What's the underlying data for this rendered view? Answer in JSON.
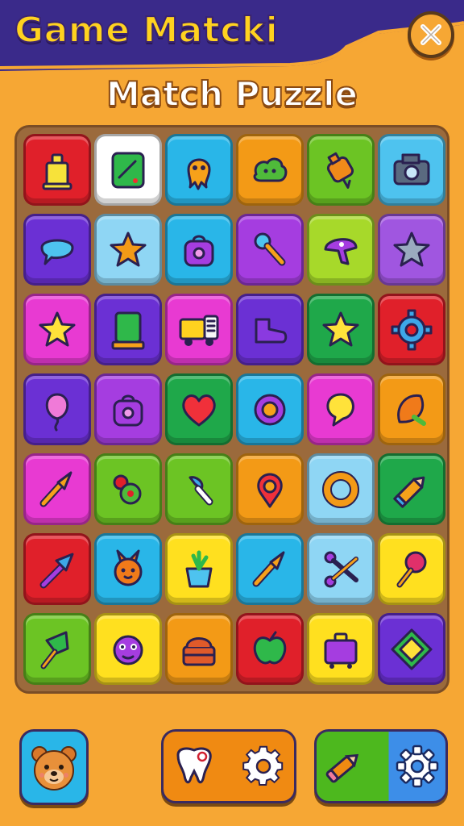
{
  "header": {
    "title": "Game Matcki",
    "subtitle": "Match Puzzle"
  },
  "colors": {
    "background": "#f6a734",
    "header": "#3a2a8a",
    "title": "#ffd21f",
    "board": "#9b6a3c"
  },
  "board": {
    "columns": 6,
    "rows": 7,
    "tiles": [
      [
        {
          "color": "#e0202a",
          "icon": "yellow-bottle-icon"
        },
        {
          "color": "#ffffff",
          "icon": "green-device-icon"
        },
        {
          "color": "#29b6e8",
          "icon": "orange-creature-icon"
        },
        {
          "color": "#f39a16",
          "icon": "green-bush-icon"
        },
        {
          "color": "#6cc424",
          "icon": "orange-flask-icon"
        },
        {
          "color": "#4ec3ef",
          "icon": "camera-icon"
        }
      ],
      [
        {
          "color": "#6b30d4",
          "icon": "speech-bubble-icon"
        },
        {
          "color": "#8fd6f4",
          "icon": "orange-star-icon"
        },
        {
          "color": "#29b6e8",
          "icon": "purple-bag-icon"
        },
        {
          "color": "#a53de0",
          "icon": "wrench-icon"
        },
        {
          "color": "#a7d92a",
          "icon": "purple-mushroom-icon"
        },
        {
          "color": "#a056e0",
          "icon": "gray-star-icon"
        }
      ],
      [
        {
          "color": "#e83ad2",
          "icon": "yellow-star-icon"
        },
        {
          "color": "#6b30d4",
          "icon": "green-card-icon"
        },
        {
          "color": "#e83ad2",
          "icon": "truck-icon"
        },
        {
          "color": "#6b30d4",
          "icon": "purple-boot-icon"
        },
        {
          "color": "#1fa84a",
          "icon": "yellow-star-icon"
        },
        {
          "color": "#e0202a",
          "icon": "blue-gear-icon"
        }
      ],
      [
        {
          "color": "#6b30d4",
          "icon": "pink-balloon-icon"
        },
        {
          "color": "#a53de0",
          "icon": "purple-bag-icon"
        },
        {
          "color": "#1fa84a",
          "icon": "heart-icon"
        },
        {
          "color": "#29b6e8",
          "icon": "purple-flower-icon"
        },
        {
          "color": "#e83ad2",
          "icon": "yellow-bubble-icon"
        },
        {
          "color": "#f39a16",
          "icon": "orange-leaf-icon"
        }
      ],
      [
        {
          "color": "#e83ad2",
          "icon": "brush-icon"
        },
        {
          "color": "#6cc424",
          "icon": "berry-icon"
        },
        {
          "color": "#6cc424",
          "icon": "blue-brush-icon"
        },
        {
          "color": "#f39a16",
          "icon": "location-pin-icon"
        },
        {
          "color": "#8fd6f4",
          "icon": "orange-ring-icon"
        },
        {
          "color": "#1fa84a",
          "icon": "pencil-icon"
        }
      ],
      [
        {
          "color": "#e0202a",
          "icon": "blue-arrow-icon"
        },
        {
          "color": "#29b6e8",
          "icon": "bunny-icon"
        },
        {
          "color": "#ffe01f",
          "icon": "plant-pot-icon"
        },
        {
          "color": "#29b6e8",
          "icon": "brush-icon"
        },
        {
          "color": "#8fd6f4",
          "icon": "scissors-icon"
        },
        {
          "color": "#ffe01f",
          "icon": "lollipop-icon"
        }
      ],
      [
        {
          "color": "#6cc424",
          "icon": "green-brush-icon"
        },
        {
          "color": "#ffe01f",
          "icon": "purple-monster-icon"
        },
        {
          "color": "#f39a16",
          "icon": "basket-icon"
        },
        {
          "color": "#e0202a",
          "icon": "green-apple-icon"
        },
        {
          "color": "#ffe01f",
          "icon": "purple-suitcase-icon"
        },
        {
          "color": "#6b30d4",
          "icon": "frame-icon"
        }
      ]
    ]
  },
  "bottom_bar": {
    "bear_button": {
      "icon": "bear-icon",
      "color": "#29b6e8"
    },
    "center_button": {
      "icons": [
        "tooth-icon",
        "gear-icon"
      ],
      "color": "#f08a12"
    },
    "right_button": {
      "icons": [
        "pencil-icon",
        "gear-icon"
      ],
      "colors": [
        "#4db81e",
        "#3d8ee8"
      ]
    }
  }
}
